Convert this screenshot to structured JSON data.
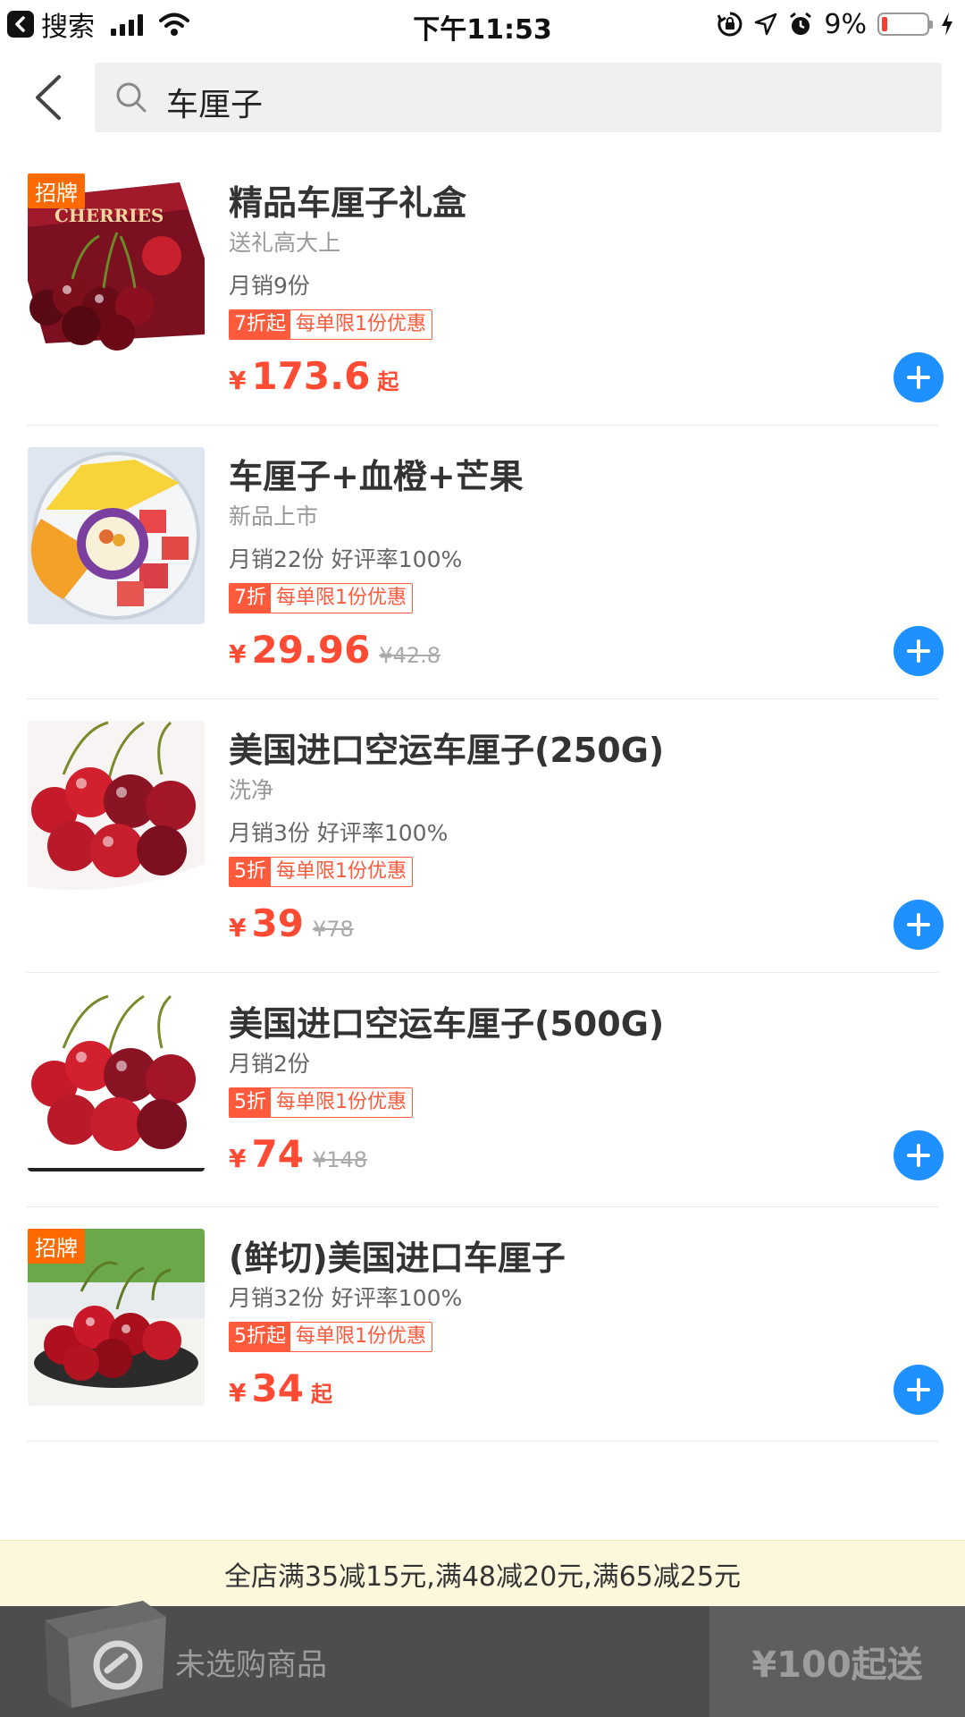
{
  "status_bar": {
    "back_label": "搜索",
    "time": "下午11:53",
    "battery": "9%",
    "battery_level_percent": 9
  },
  "search": {
    "query": "车厘子"
  },
  "products": [
    {
      "badge": "招牌",
      "title": "精品车厘子礼盒",
      "subtitle": "送礼高大上",
      "sales": "月销9份",
      "discount": "7折起",
      "limit": "每单限1份优惠",
      "yen": "¥",
      "price": "173.6",
      "suffix": "起",
      "old_price": ""
    },
    {
      "badge": "",
      "title": "车厘子+血橙+芒果",
      "subtitle": "新品上市",
      "sales": "月销22份 好评率100%",
      "discount": "7折",
      "limit": "每单限1份优惠",
      "yen": "¥",
      "price": "29.96",
      "suffix": "",
      "old_price": "¥42.8"
    },
    {
      "badge": "",
      "title": "美国进口空运车厘子(250G)",
      "subtitle": "洗净",
      "sales": "月销3份 好评率100%",
      "discount": "5折",
      "limit": "每单限1份优惠",
      "yen": "¥",
      "price": "39",
      "suffix": "",
      "old_price": "¥78"
    },
    {
      "badge": "",
      "title": "美国进口空运车厘子(500G)",
      "subtitle": "",
      "sales": "月销2份",
      "discount": "5折",
      "limit": "每单限1份优惠",
      "yen": "¥",
      "price": "74",
      "suffix": "",
      "old_price": "¥148"
    },
    {
      "badge": "招牌",
      "title": "(鲜切)美国进口车厘子",
      "subtitle": "",
      "sales": "月销32份 好评率100%",
      "discount": "5折起",
      "limit": "每单限1份优惠",
      "yen": "¥",
      "price": "34",
      "suffix": "起",
      "old_price": ""
    }
  ],
  "notice": "全店满35减15元,满48减20元,满65减25元",
  "cart": {
    "empty_text": "未选购商品",
    "min_order": "¥100起送"
  },
  "colors": {
    "accent_blue": "#1e90ff",
    "price_red": "#ff4b33",
    "badge_orange": "#ff6a00",
    "notice_bg": "#fdf8dc",
    "cart_bar": "#4d4d4d"
  },
  "icons": [
    "back-badge-icon",
    "signal-icon",
    "wifi-icon",
    "lock-rotation-icon",
    "location-icon",
    "alarm-icon",
    "battery-icon",
    "charging-icon",
    "chevron-left-icon",
    "search-icon",
    "plus-icon",
    "cart-box-icon"
  ]
}
